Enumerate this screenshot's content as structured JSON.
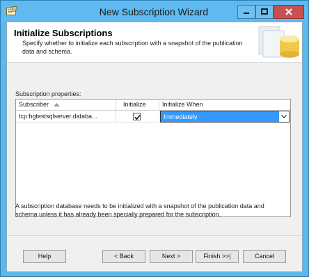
{
  "window": {
    "title": "New Subscription Wizard",
    "icon": "wizard-app-icon"
  },
  "header": {
    "title": "Initialize Subscriptions",
    "description": "Specify whether to initialize each subscription with a snapshot of the publication data and schema."
  },
  "grid": {
    "label": "Subscription properties:",
    "columns": [
      "Subscriber",
      "Initialize",
      "Initialize When"
    ],
    "rows": [
      {
        "subscriber": "tcp:bgtestsqlserver.databa...",
        "initialize": true,
        "initialize_when": "Immediately"
      }
    ]
  },
  "note": "A subscription database needs to be initialized with a snapshot of the publication data and schema unless it has already been specially prepared for the subscription.",
  "buttons": {
    "help": "Help",
    "back": "< Back",
    "next": "Next >",
    "finish": "Finish >>|",
    "cancel": "Cancel"
  },
  "colors": {
    "titlebar": "#5ebaf0",
    "selection": "#3399ff",
    "close_button": "#c75050"
  }
}
